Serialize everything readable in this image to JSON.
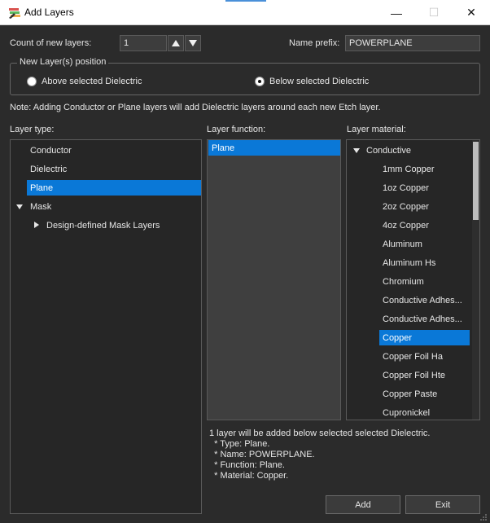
{
  "window": {
    "title": "Add Layers",
    "minimize_glyph": "—",
    "maximize_glyph": "☐",
    "close_glyph": "✕"
  },
  "count": {
    "label": "Count of new layers:",
    "value": "1"
  },
  "prefix": {
    "label": "Name prefix:",
    "value": "POWERPLANE"
  },
  "position": {
    "title": "New Layer(s) position",
    "options": [
      {
        "label": "Above selected Dielectric",
        "checked": false
      },
      {
        "label": "Below selected Dielectric",
        "checked": true
      }
    ]
  },
  "note": "Note: Adding Conductor or Plane layers will add Dielectric layers around each new Etch layer.",
  "layer_type": {
    "header": "Layer type:",
    "items": [
      "Conductor",
      "Dielectric",
      "Plane",
      "Mask",
      "Design-defined Mask Layers"
    ],
    "selected": "Plane"
  },
  "layer_function": {
    "header": "Layer function:",
    "items": [
      "Plane"
    ],
    "selected": "Plane"
  },
  "layer_material": {
    "header": "Layer material:",
    "group": "Conductive",
    "items": [
      "1mm Copper",
      "1oz Copper",
      "2oz Copper",
      "4oz Copper",
      "Aluminum",
      "Aluminum Hs",
      "Chromium",
      "Conductive Adhes...",
      "Conductive Adhes...",
      "Copper",
      "Copper Foil Ha",
      "Copper Foil Hte",
      "Copper Paste",
      "Cupronickel"
    ],
    "selected": "Copper",
    "scroll_fraction": 0.28
  },
  "summary": {
    "lines": [
      "1 layer will be added below selected selected Dielectric.",
      "  * Type: Plane.",
      "  * Name: POWERPLANE.",
      "  * Function: Plane.",
      "  * Material: Copper."
    ]
  },
  "buttons": {
    "add": "Add",
    "exit": "Exit"
  },
  "colors": {
    "selection": "#0a78d7",
    "background": "#2b2b2b"
  }
}
